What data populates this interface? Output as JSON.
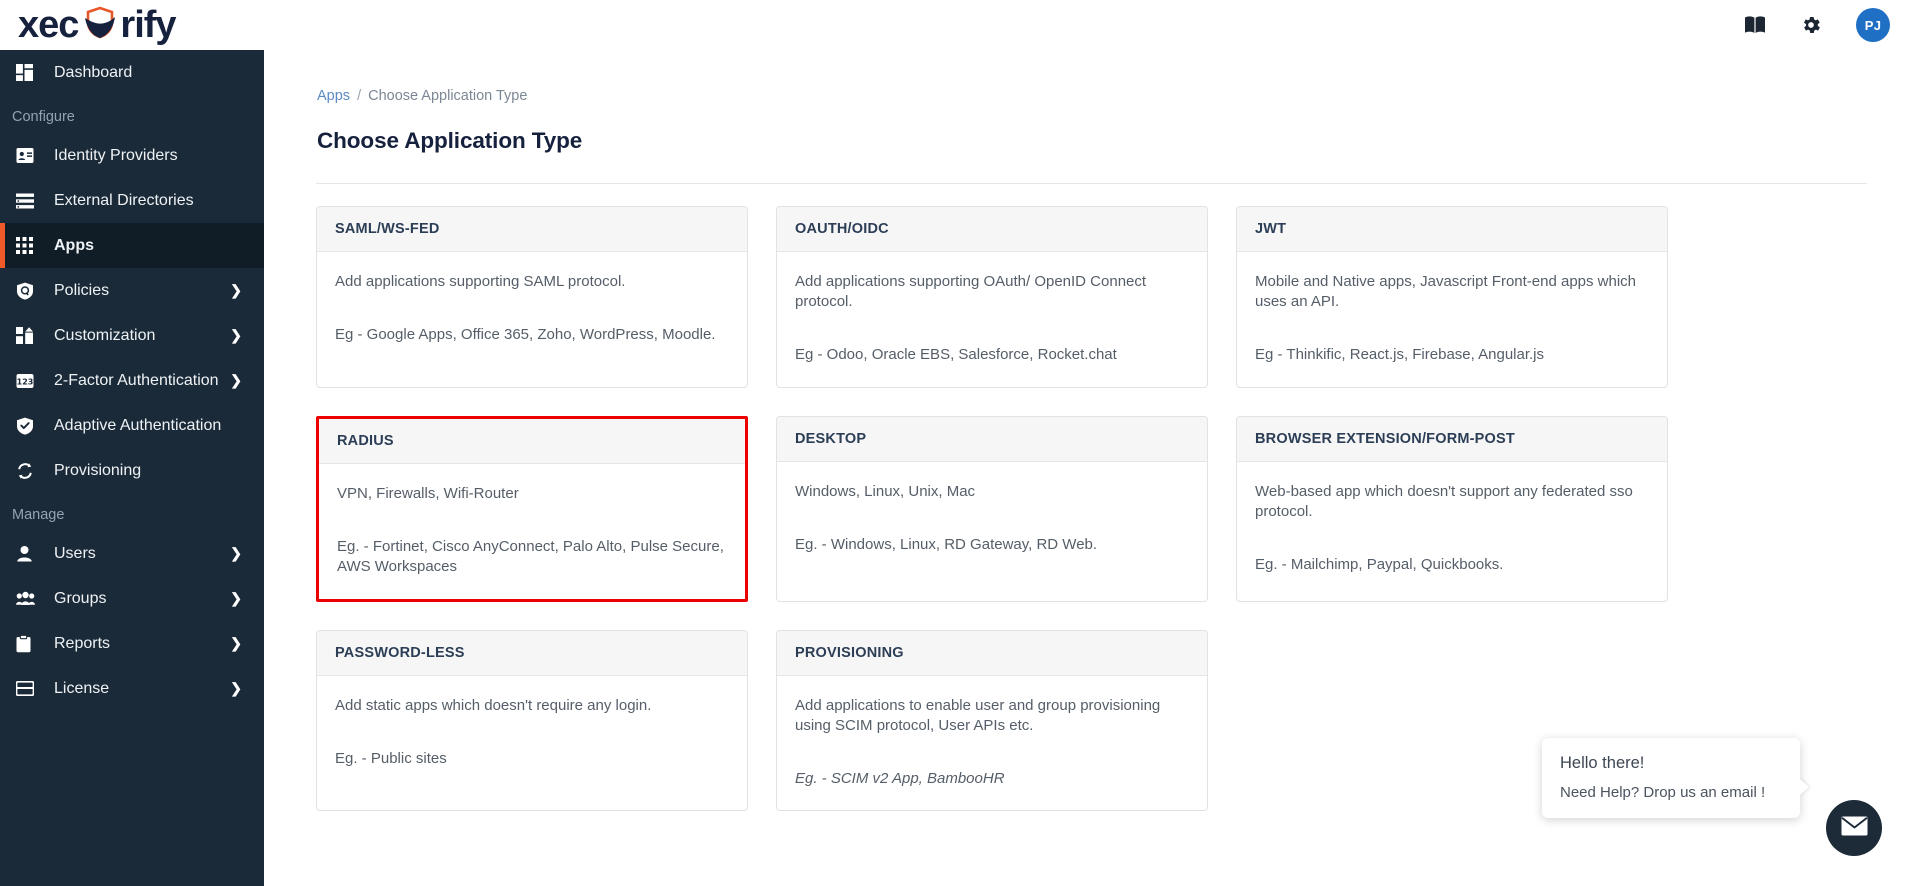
{
  "header": {
    "logo_text_left": "xec",
    "logo_text_right": "rify",
    "logo_icon": "shield-icon",
    "docs_icon": "book-icon",
    "settings_icon": "gear-icon",
    "avatar_initials": "PJ",
    "accent_color": "#f05a28",
    "avatar_color": "#1f6fc4"
  },
  "sidebar": {
    "items": [
      {
        "label": "Dashboard",
        "icon": "dashboard-icon",
        "chevron": false,
        "active": false
      },
      {
        "label": "Identity Providers",
        "icon": "id-card-icon",
        "chevron": false,
        "active": false
      },
      {
        "label": "External Directories",
        "icon": "list-icon",
        "chevron": false,
        "active": false
      },
      {
        "label": "Apps",
        "icon": "grid-apps-icon",
        "chevron": false,
        "active": true
      },
      {
        "label": "Policies",
        "icon": "policy-shield-icon",
        "chevron": true,
        "active": false
      },
      {
        "label": "Customization",
        "icon": "customization-icon",
        "chevron": true,
        "active": false
      },
      {
        "label": "2-Factor Authentication",
        "icon": "numpad-123-icon",
        "chevron": true,
        "active": false
      },
      {
        "label": "Adaptive Authentication",
        "icon": "shield-check-icon",
        "chevron": false,
        "active": false
      },
      {
        "label": "Provisioning",
        "icon": "sync-icon",
        "chevron": false,
        "active": false
      },
      {
        "label": "Users",
        "icon": "user-icon",
        "chevron": true,
        "active": false
      },
      {
        "label": "Groups",
        "icon": "users-group-icon",
        "chevron": true,
        "active": false
      },
      {
        "label": "Reports",
        "icon": "clipboard-icon",
        "chevron": true,
        "active": false
      },
      {
        "label": "License",
        "icon": "card-icon",
        "chevron": true,
        "active": false
      }
    ],
    "section_configure": "Configure",
    "section_manage": "Manage"
  },
  "breadcrumb": {
    "root": "Apps",
    "separator": "/",
    "current": "Choose Application Type"
  },
  "page": {
    "title": "Choose Application Type"
  },
  "cards": [
    {
      "title": "SAML/WS-FED",
      "description": "Add applications supporting SAML protocol.",
      "example": "Eg - Google Apps, Office 365, Zoho, WordPress, Moodle.",
      "example_italic": false,
      "highlighted": false
    },
    {
      "title": "OAUTH/OIDC",
      "description": "Add applications supporting OAuth/ OpenID Connect protocol.",
      "example": "Eg - Odoo, Oracle EBS, Salesforce, Rocket.chat",
      "example_italic": false,
      "highlighted": false
    },
    {
      "title": "JWT",
      "description": "Mobile and Native apps, Javascript Front-end apps which uses an API.",
      "example": "Eg - Thinkific, React.js, Firebase, Angular.js",
      "example_italic": false,
      "highlighted": false
    },
    {
      "title": "RADIUS",
      "description": "VPN, Firewalls, Wifi-Router",
      "example": "Eg. - Fortinet, Cisco AnyConnect, Palo Alto, Pulse Secure, AWS Workspaces",
      "example_italic": false,
      "highlighted": true
    },
    {
      "title": "DESKTOP",
      "description": "Windows, Linux, Unix, Mac",
      "example": "Eg. - Windows, Linux, RD Gateway, RD Web.",
      "example_italic": false,
      "highlighted": false
    },
    {
      "title": "BROWSER EXTENSION/FORM-POST",
      "description": "Web-based app which doesn't support any federated sso protocol.",
      "example": "Eg. - Mailchimp, Paypal, Quickbooks.",
      "example_italic": false,
      "highlighted": false
    },
    {
      "title": "PASSWORD-LESS",
      "description": "Add static apps which doesn't require any login.",
      "example": "Eg. - Public sites",
      "example_italic": false,
      "highlighted": false
    },
    {
      "title": "PROVISIONING",
      "description": "Add applications to enable user and group provisioning using SCIM protocol, User APIs etc.",
      "example": "Eg. - SCIM v2 App, BambooHR",
      "example_italic": true,
      "highlighted": false
    }
  ],
  "chat": {
    "greeting": "Hello there!",
    "prompt": "Need Help? Drop us an email !",
    "fab_icon": "envelope-icon"
  },
  "highlight_color": "#ee0000"
}
